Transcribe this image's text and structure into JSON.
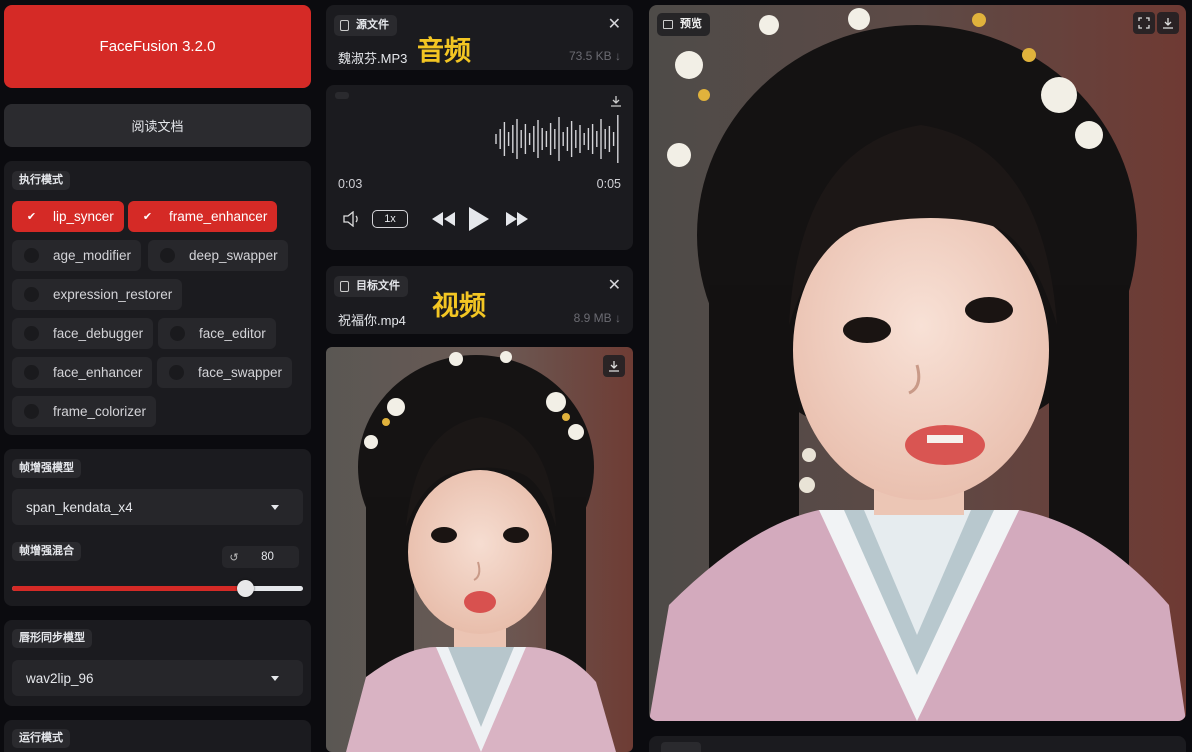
{
  "app": {
    "title": "FaceFusion 3.2.0",
    "docs_button": "阅读文档"
  },
  "execution": {
    "label": "执行模式",
    "processors": [
      {
        "name": "lip_syncer",
        "checked": true
      },
      {
        "name": "frame_enhancer",
        "checked": true
      },
      {
        "name": "age_modifier",
        "checked": false
      },
      {
        "name": "deep_swapper",
        "checked": false
      },
      {
        "name": "expression_restorer",
        "checked": false
      },
      {
        "name": "face_debugger",
        "checked": false
      },
      {
        "name": "face_editor",
        "checked": false
      },
      {
        "name": "face_enhancer",
        "checked": false
      },
      {
        "name": "face_swapper",
        "checked": false
      },
      {
        "name": "frame_colorizer",
        "checked": false
      }
    ]
  },
  "frame_enhancer": {
    "model_label": "帧增强模型",
    "model_value": "span_kendata_x4",
    "blend_label": "帧增强混合",
    "blend_value": "80",
    "blend_fraction": 0.8
  },
  "lip_sync": {
    "model_label": "唇形同步模型",
    "model_value": "wav2lip_96"
  },
  "run_mode": {
    "label": "运行模式"
  },
  "source": {
    "tag": "源文件",
    "filename": "魏淑芬.MP3",
    "size": "73.5 KB ↓",
    "overlay_label": "音频",
    "time_current": "0:03",
    "time_total": "0:05",
    "speed": "1x"
  },
  "target": {
    "tag": "目标文件",
    "filename": "祝福你.mp4",
    "size": "8.9 MB ↓",
    "overlay_label": "视频"
  },
  "preview": {
    "tag": "预览"
  },
  "colors": {
    "accent": "#d52a26",
    "panel": "#1b1b1f",
    "highlight": "#f3c623"
  },
  "icons": [
    "file-icon",
    "close-icon",
    "download-icon",
    "volume-icon",
    "rewind-icon",
    "play-icon",
    "fast-forward-icon",
    "image-icon",
    "fullscreen-icon",
    "checkmark-icon",
    "reset-icon"
  ]
}
